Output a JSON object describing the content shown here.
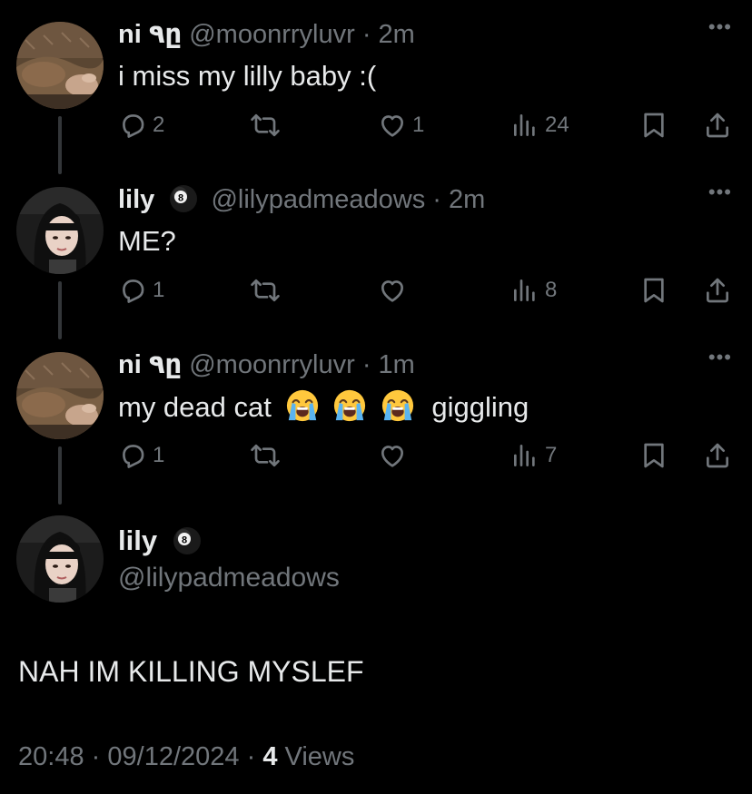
{
  "tweets": [
    {
      "name": "ni ٩ը",
      "handle": "@moonrryluvr",
      "separator": "·",
      "time": "2m",
      "text": "i miss my lilly baby :(",
      "replies": "2",
      "retweets": "",
      "likes": "1",
      "views": "24",
      "avatar": "brown-sweater-photo"
    },
    {
      "name": "lily",
      "handle": "@lilypadmeadows",
      "separator": "·",
      "time": "2m",
      "text": "ME?",
      "replies": "1",
      "retweets": "",
      "likes": "",
      "views": "8",
      "avatar": "selfie-photo"
    },
    {
      "name": "ni ٩ը",
      "handle": "@moonrryluvr",
      "separator": "·",
      "time": "1m",
      "text": "my dead cat",
      "emojis": [
        "loudly-crying-face",
        "loudly-crying-face",
        "loudly-crying-face"
      ],
      "text_after": "giggling",
      "replies": "1",
      "retweets": "",
      "likes": "",
      "views": "7",
      "avatar": "brown-sweater-photo"
    }
  ],
  "focus": {
    "name": "lily",
    "handle": "@lilypadmeadows",
    "text": "NAH IM KILLING MYSLEF",
    "time": "20:48",
    "date": "09/12/2024",
    "separator": "·",
    "views_count": "4",
    "views_label": "Views",
    "avatar": "selfie-photo"
  },
  "icons": {
    "more": "more-horizontal-icon",
    "reply": "reply-bubble-icon",
    "retweet": "retweet-icon",
    "like": "heart-icon",
    "views": "views-bar-chart-icon",
    "bookmark": "bookmark-icon",
    "share": "share-upload-icon",
    "badge": "pool-8-ball-emoji",
    "emoji": "loudly-crying-face"
  },
  "colors": {
    "background": "#000000",
    "text_primary": "#e7e9ea",
    "text_secondary": "#71767b",
    "thread_line": "#333639"
  }
}
